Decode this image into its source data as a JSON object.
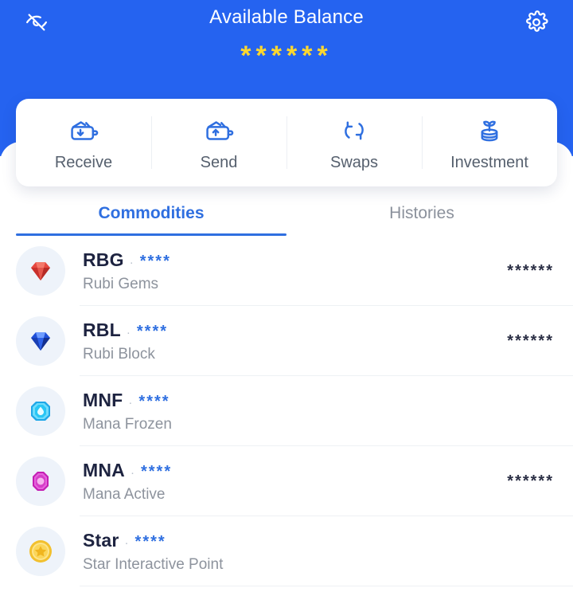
{
  "header": {
    "title": "Available Balance",
    "balance_masked": "******",
    "hide_balance_icon": "eye-off-icon",
    "settings_icon": "gear-icon",
    "background_color": "#2563f0",
    "balance_color": "#ffd82e"
  },
  "actions": [
    {
      "label": "Receive",
      "icon": "wallet-download-icon"
    },
    {
      "label": "Send",
      "icon": "wallet-upload-icon"
    },
    {
      "label": "Swaps",
      "icon": "swap-arrows-icon"
    },
    {
      "label": "Investment",
      "icon": "plant-coins-icon"
    }
  ],
  "tabs": [
    {
      "label": "Commodities",
      "active": true
    },
    {
      "label": "Histories",
      "active": false
    }
  ],
  "accent_color": "#2f6fe0",
  "assets": [
    {
      "symbol": "RBG",
      "separator": "·",
      "amount_masked": "****",
      "name": "Rubi Gems",
      "value_masked": "******",
      "icon": "red-gem-icon"
    },
    {
      "symbol": "RBL",
      "separator": "·",
      "amount_masked": "****",
      "name": "Rubi Block",
      "value_masked": "******",
      "icon": "blue-diamond-icon"
    },
    {
      "symbol": "MNF",
      "separator": "·",
      "amount_masked": "****",
      "name": "Mana Frozen",
      "value_masked": "",
      "icon": "cyan-frozen-gem-icon"
    },
    {
      "symbol": "MNA",
      "separator": "·",
      "amount_masked": "****",
      "name": "Mana Active",
      "value_masked": "******",
      "icon": "magenta-gem-icon"
    },
    {
      "symbol": "Star",
      "separator": "·",
      "amount_masked": "****",
      "name": "Star Interactive Point",
      "value_masked": "",
      "icon": "gold-star-coin-icon"
    }
  ]
}
